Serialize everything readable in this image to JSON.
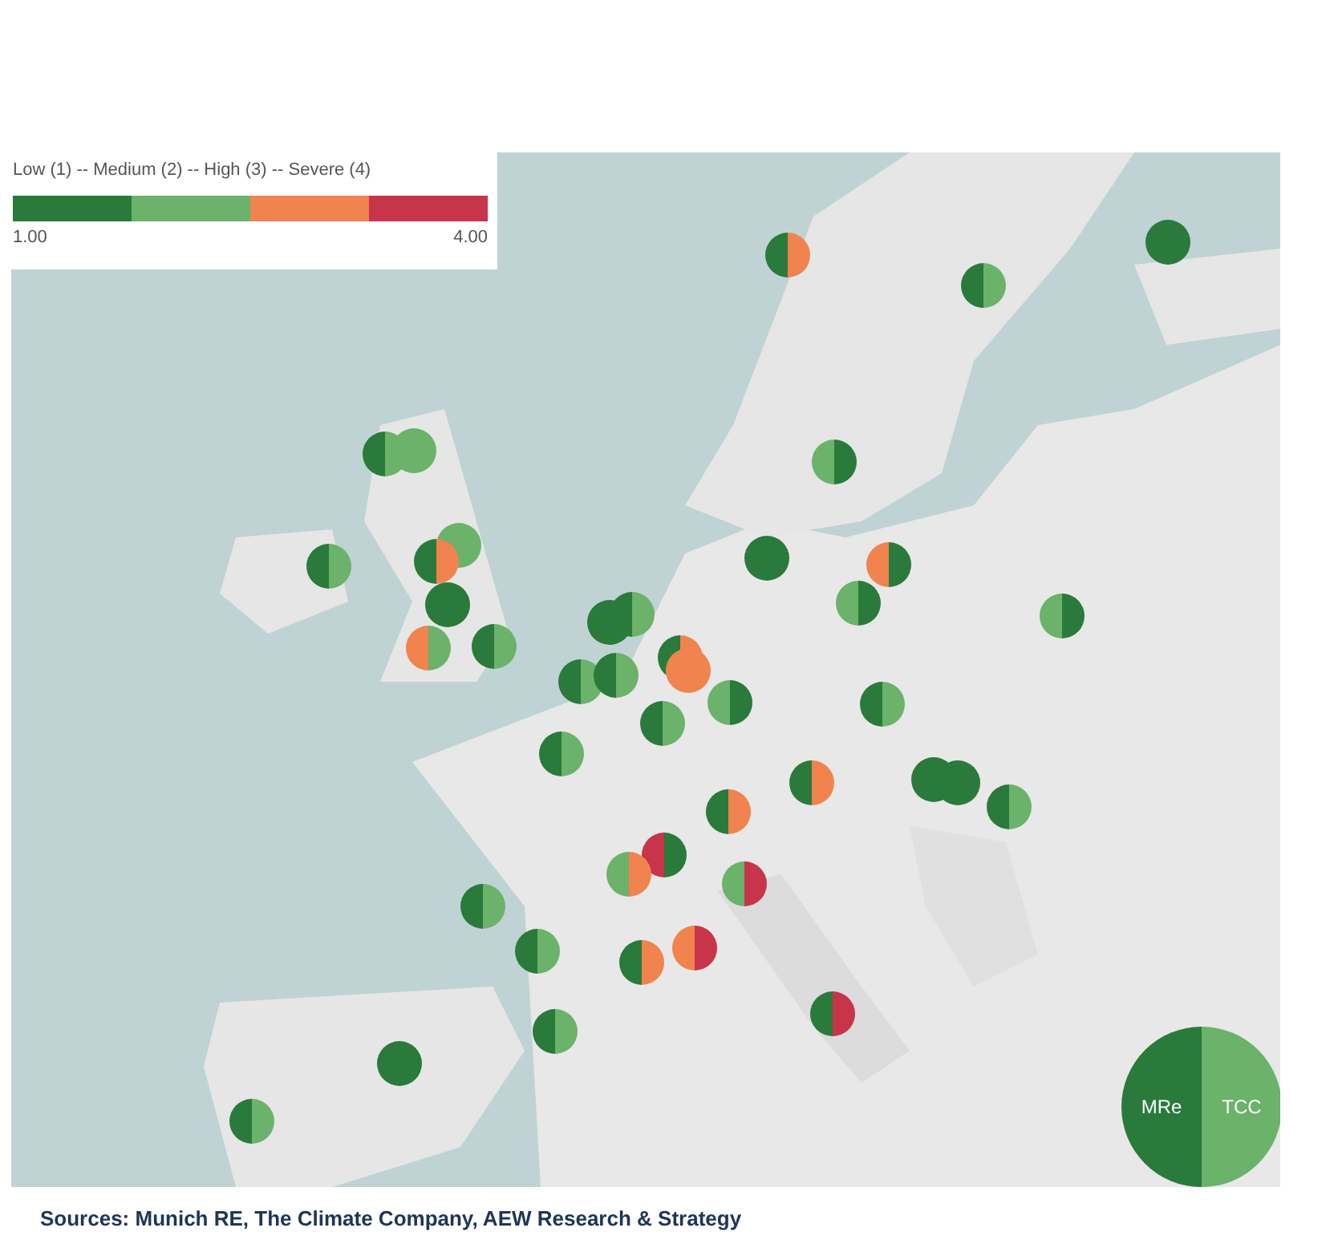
{
  "legend": {
    "title": "Low (1) -- Medium (2) -- High (3) -- Severe (4)",
    "segments": [
      {
        "color": "#2a7a3b"
      },
      {
        "color": "#6bb26a"
      },
      {
        "color": "#f0834e"
      },
      {
        "color": "#c8344a"
      }
    ],
    "min_label": "1.00",
    "max_label": "4.00"
  },
  "markers": [
    {
      "halves": [
        {
          "color": "#2a7a3b"
        },
        {
          "color": "#f0834e"
        }
      ]
    },
    {
      "halves": [
        {
          "color": "#2a7a3b"
        },
        {
          "color": "#6bb26a"
        }
      ]
    },
    {
      "halves": [
        {
          "color": "#2a7a3b"
        },
        {
          "color": "#2a7a3b"
        }
      ]
    },
    {
      "halves": [
        {
          "color": "#2a7a3b"
        },
        {
          "color": "#6bb26a"
        }
      ]
    },
    {
      "halves": [
        {
          "color": "#6bb26a"
        },
        {
          "color": "#6bb26a"
        }
      ]
    },
    {
      "halves": [
        {
          "color": "#6bb26a"
        },
        {
          "color": "#2a7a3b"
        }
      ]
    },
    {
      "halves": [
        {
          "color": "#2a7a3b"
        },
        {
          "color": "#6bb26a"
        }
      ]
    },
    {
      "halves": [
        {
          "color": "#6bb26a"
        },
        {
          "color": "#6bb26a"
        }
      ]
    },
    {
      "halves": [
        {
          "color": "#2a7a3b"
        },
        {
          "color": "#f0834e"
        }
      ]
    },
    {
      "halves": [
        {
          "color": "#2a7a3b"
        },
        {
          "color": "#2a7a3b"
        }
      ]
    },
    {
      "halves": [
        {
          "color": "#f0834e"
        },
        {
          "color": "#2a7a3b"
        }
      ]
    },
    {
      "halves": [
        {
          "color": "#2a7a3b"
        },
        {
          "color": "#2a7a3b"
        }
      ]
    },
    {
      "halves": [
        {
          "color": "#6bb26a"
        },
        {
          "color": "#2a7a3b"
        }
      ]
    },
    {
      "halves": [
        {
          "color": "#6bb26a"
        },
        {
          "color": "#2a7a3b"
        }
      ]
    },
    {
      "halves": [
        {
          "color": "#2a7a3b"
        },
        {
          "color": "#6bb26a"
        }
      ]
    },
    {
      "halves": [
        {
          "color": "#2a7a3b"
        },
        {
          "color": "#2a7a3b"
        }
      ]
    },
    {
      "halves": [
        {
          "color": "#f0834e"
        },
        {
          "color": "#6bb26a"
        }
      ]
    },
    {
      "halves": [
        {
          "color": "#2a7a3b"
        },
        {
          "color": "#6bb26a"
        }
      ]
    },
    {
      "halves": [
        {
          "color": "#2a7a3b"
        },
        {
          "color": "#f0834e"
        }
      ]
    },
    {
      "halves": [
        {
          "color": "#2a7a3b"
        },
        {
          "color": "#6bb26a"
        }
      ]
    },
    {
      "halves": [
        {
          "color": "#2a7a3b"
        },
        {
          "color": "#6bb26a"
        }
      ]
    },
    {
      "halves": [
        {
          "color": "#f0834e"
        },
        {
          "color": "#f0834e"
        }
      ]
    },
    {
      "halves": [
        {
          "color": "#6bb26a"
        },
        {
          "color": "#2a7a3b"
        }
      ]
    },
    {
      "halves": [
        {
          "color": "#2a7a3b"
        },
        {
          "color": "#6bb26a"
        }
      ]
    },
    {
      "halves": [
        {
          "color": "#2a7a3b"
        },
        {
          "color": "#6bb26a"
        }
      ]
    },
    {
      "halves": [
        {
          "color": "#2a7a3b"
        },
        {
          "color": "#6bb26a"
        }
      ]
    },
    {
      "halves": [
        {
          "color": "#2a7a3b"
        },
        {
          "color": "#f0834e"
        }
      ]
    },
    {
      "halves": [
        {
          "color": "#2a7a3b"
        },
        {
          "color": "#2a7a3b"
        }
      ]
    },
    {
      "halves": [
        {
          "color": "#2a7a3b"
        },
        {
          "color": "#2a7a3b"
        }
      ]
    },
    {
      "halves": [
        {
          "color": "#2a7a3b"
        },
        {
          "color": "#6bb26a"
        }
      ]
    },
    {
      "halves": [
        {
          "color": "#2a7a3b"
        },
        {
          "color": "#f0834e"
        }
      ]
    },
    {
      "halves": [
        {
          "color": "#c8344a"
        },
        {
          "color": "#2a7a3b"
        }
      ]
    },
    {
      "halves": [
        {
          "color": "#6bb26a"
        },
        {
          "color": "#f0834e"
        }
      ]
    },
    {
      "halves": [
        {
          "color": "#6bb26a"
        },
        {
          "color": "#c8344a"
        }
      ]
    },
    {
      "halves": [
        {
          "color": "#2a7a3b"
        },
        {
          "color": "#6bb26a"
        }
      ]
    },
    {
      "halves": [
        {
          "color": "#f0834e"
        },
        {
          "color": "#c8344a"
        }
      ]
    },
    {
      "halves": [
        {
          "color": "#2a7a3b"
        },
        {
          "color": "#f0834e"
        }
      ]
    },
    {
      "halves": [
        {
          "color": "#2a7a3b"
        },
        {
          "color": "#6bb26a"
        }
      ]
    },
    {
      "halves": [
        {
          "color": "#2a7a3b"
        },
        {
          "color": "#c8344a"
        }
      ]
    },
    {
      "halves": [
        {
          "color": "#2a7a3b"
        },
        {
          "color": "#6bb26a"
        }
      ]
    },
    {
      "halves": [
        {
          "color": "#2a7a3b"
        },
        {
          "color": "#2a7a3b"
        }
      ]
    },
    {
      "halves": [
        {
          "color": "#2a7a3b"
        },
        {
          "color": "#6bb26a"
        }
      ]
    }
  ],
  "key": {
    "halves": [
      {
        "label": "MRe",
        "color": "#2a7a3b"
      },
      {
        "label": "TCC",
        "color": "#6bb26a"
      }
    ]
  },
  "source": "Sources: Munich RE, The Climate Company, AEW Research & Strategy"
}
